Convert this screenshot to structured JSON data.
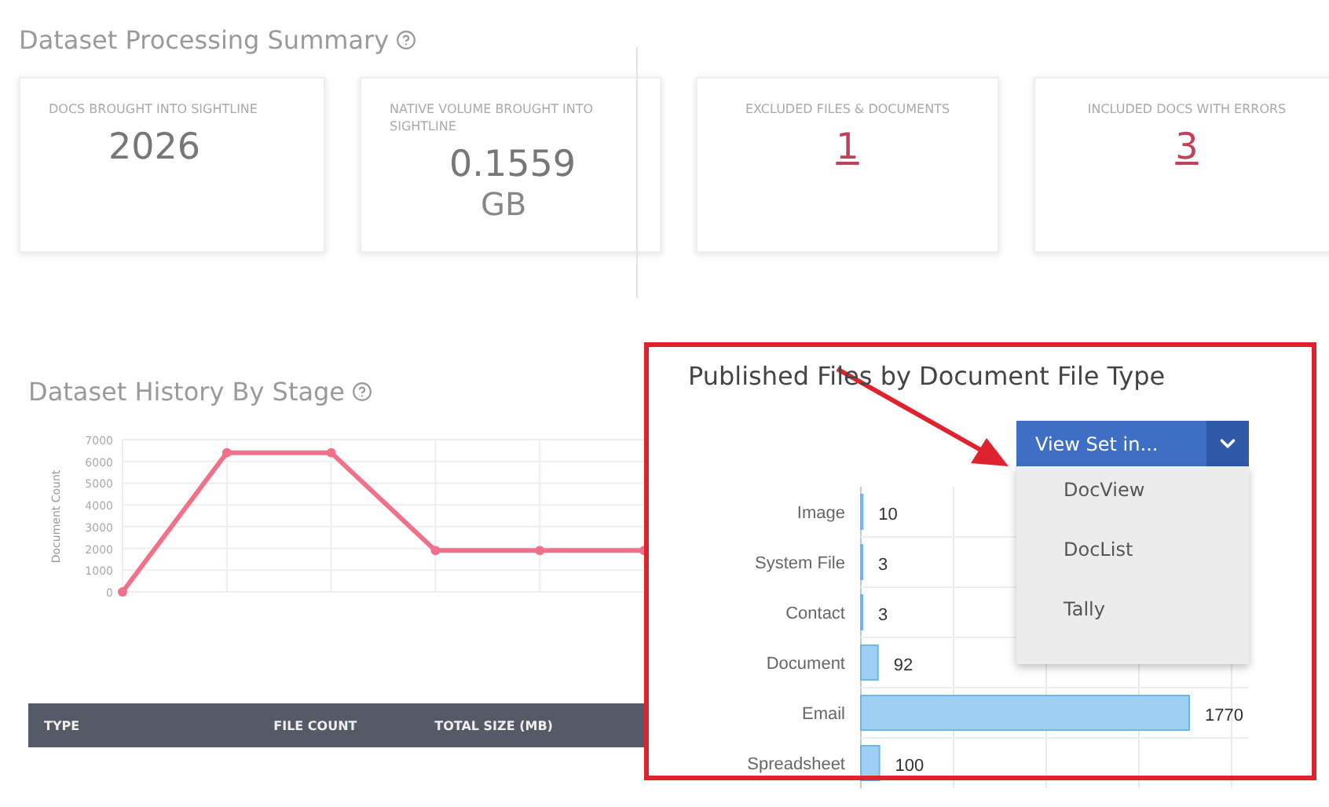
{
  "summary": {
    "title": "Dataset Processing Summary",
    "cards": [
      {
        "label": "DOCS BROUGHT INTO SIGHTLINE",
        "value": "2026",
        "kind": "plain"
      },
      {
        "label": "NATIVE VOLUME BROUGHT INTO SIGHTLINE",
        "value": "0.1559",
        "unit": "GB",
        "kind": "plain"
      },
      {
        "label": "EXCLUDED FILES & DOCUMENTS",
        "value": "1",
        "kind": "link"
      },
      {
        "label": "INCLUDED DOCS WITH ERRORS",
        "value": "3",
        "kind": "link"
      }
    ]
  },
  "history": {
    "title": "Dataset History By Stage",
    "chart_data": {
      "type": "line",
      "ylabel": "Document Count",
      "ylim": [
        0,
        7000
      ],
      "grid": true,
      "marker": true,
      "yticks": [
        0,
        1000,
        2000,
        3000,
        4000,
        5000,
        6000,
        7000
      ],
      "values": [
        0,
        6400,
        6400,
        1900,
        1900,
        1900
      ]
    }
  },
  "table": {
    "columns": [
      "TYPE",
      "FILE COUNT",
      "TOTAL SIZE (MB)"
    ]
  },
  "published": {
    "title": "Published Files by Document File Type",
    "view_button": {
      "label": "View Set in...",
      "expanded": true
    },
    "menu": [
      "DocView",
      "DocList",
      "Tally"
    ],
    "chart_data": {
      "type": "bar",
      "orientation": "horizontal",
      "categories": [
        "Image",
        "System File",
        "Contact",
        "Document",
        "Email",
        "Spreadsheet"
      ],
      "values": [
        10,
        3,
        3,
        92,
        1770,
        100
      ],
      "data_labels": true
    }
  }
}
